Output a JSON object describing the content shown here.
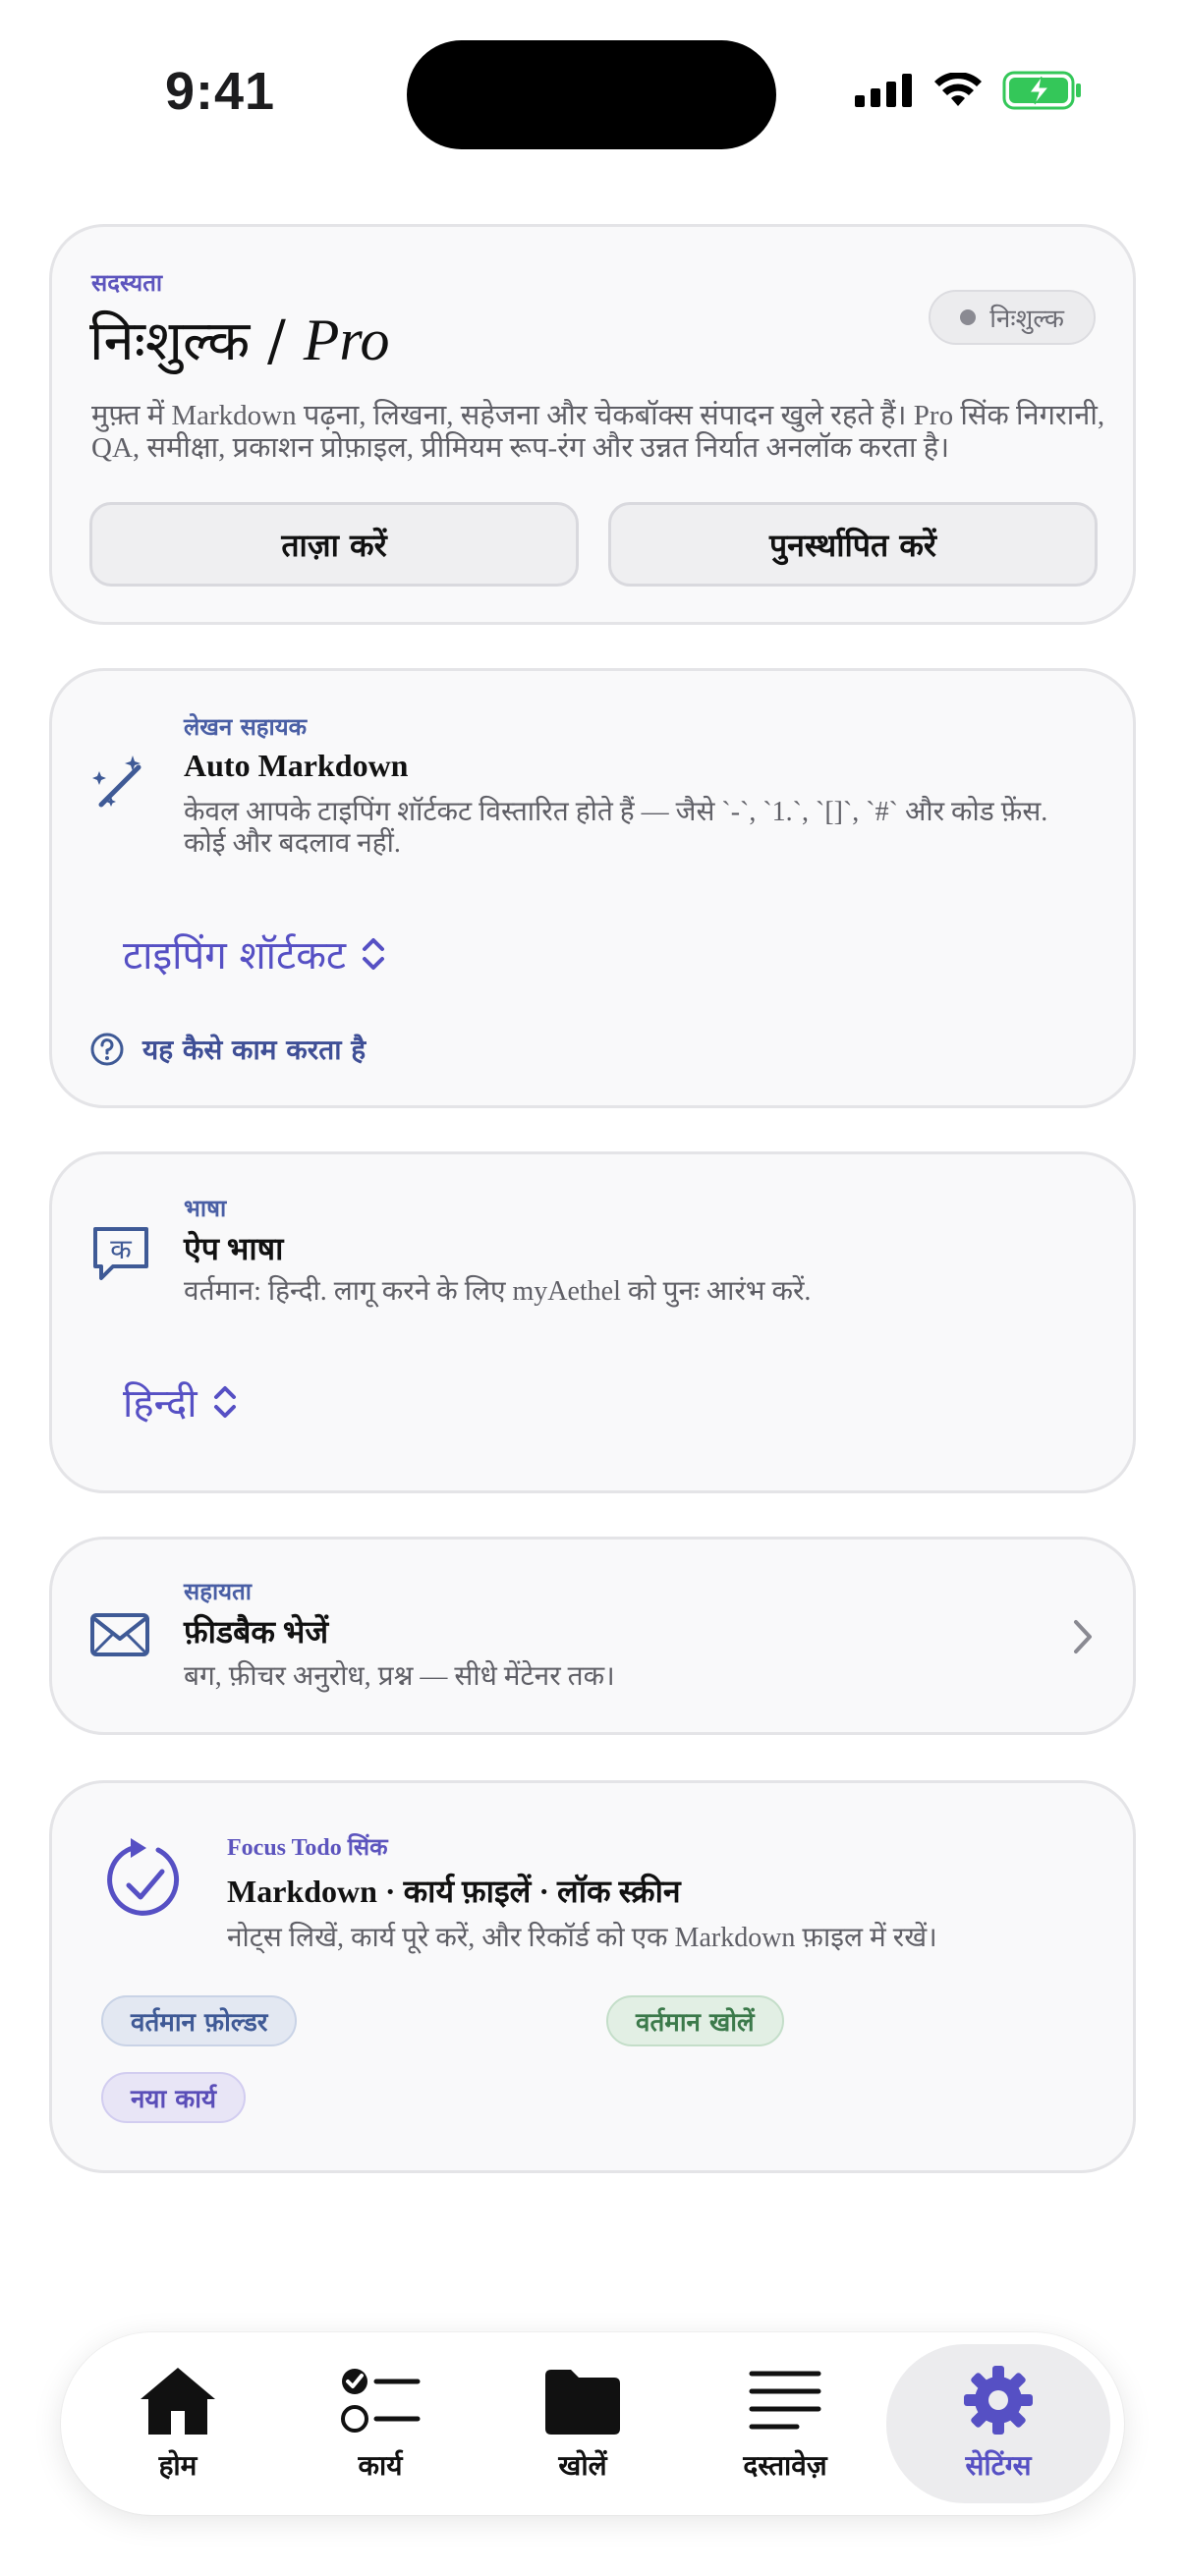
{
  "status_bar": {
    "time": "9:41"
  },
  "subscription": {
    "eyebrow": "सदस्यता",
    "title_prefix": "निःशुल्क / ",
    "title_pro": "Pro",
    "badge": "निःशुल्क",
    "description": "मुफ़्त में Markdown पढ़ना, लिखना, सहेजना और चेकबॉक्स संपादन खुले रहते हैं। Pro सिंक निगरानी, QA, समीक्षा, प्रकाशन प्रोफ़ाइल, प्रीमियम रूप-रंग और उन्नत निर्यात अनलॉक करता है।",
    "refresh_label": "ताज़ा करें",
    "restore_label": "पुनर्स्थापित करें"
  },
  "writing": {
    "eyebrow": "लेखन सहायक",
    "title": "Auto Markdown",
    "description": "केवल आपके टाइपिंग शॉर्टकट विस्तारित होते हैं — जैसे `-`, `1.`, `[]`, `#` और कोड फ़ेंस. कोई और बदलाव नहीं.",
    "picker_value": "टाइपिंग शॉर्टकट",
    "howto_label": "यह कैसे काम करता है"
  },
  "language": {
    "eyebrow": "भाषा",
    "icon_glyph": "क",
    "title": "ऐप भाषा",
    "description": "वर्तमान: हिन्दी. लागू करने के लिए myAethel को पुनः आरंभ करें.",
    "picker_value": "हिन्दी"
  },
  "help": {
    "eyebrow": "सहायता",
    "title": "फ़ीडबैक भेजें",
    "description": "बग, फ़ीचर अनुरोध, प्रश्न — सीधे मेंटेनर तक।"
  },
  "focus_sync": {
    "eyebrow": "Focus Todo सिंक",
    "title": "Markdown · कार्य फ़ाइलें · लॉक स्क्रीन",
    "description": "नोट्स लिखें, कार्य पूरे करें, और रिकॉर्ड को एक Markdown फ़ाइल में रखें।",
    "chips": [
      "वर्तमान फ़ोल्डर",
      "वर्तमान खोलें",
      "नया कार्य"
    ]
  },
  "tabs": [
    {
      "label": "होम",
      "icon": "house-icon"
    },
    {
      "label": "कार्य",
      "icon": "checklist-icon"
    },
    {
      "label": "खोलें",
      "icon": "folder-icon"
    },
    {
      "label": "दस्तावेज़",
      "icon": "lines-icon"
    },
    {
      "label": "सेटिंग्स",
      "icon": "gear-icon",
      "active": true
    }
  ],
  "colors": {
    "accent": "#5650c4",
    "link_blue": "#3f4f96",
    "battery_green": "#34c759"
  }
}
